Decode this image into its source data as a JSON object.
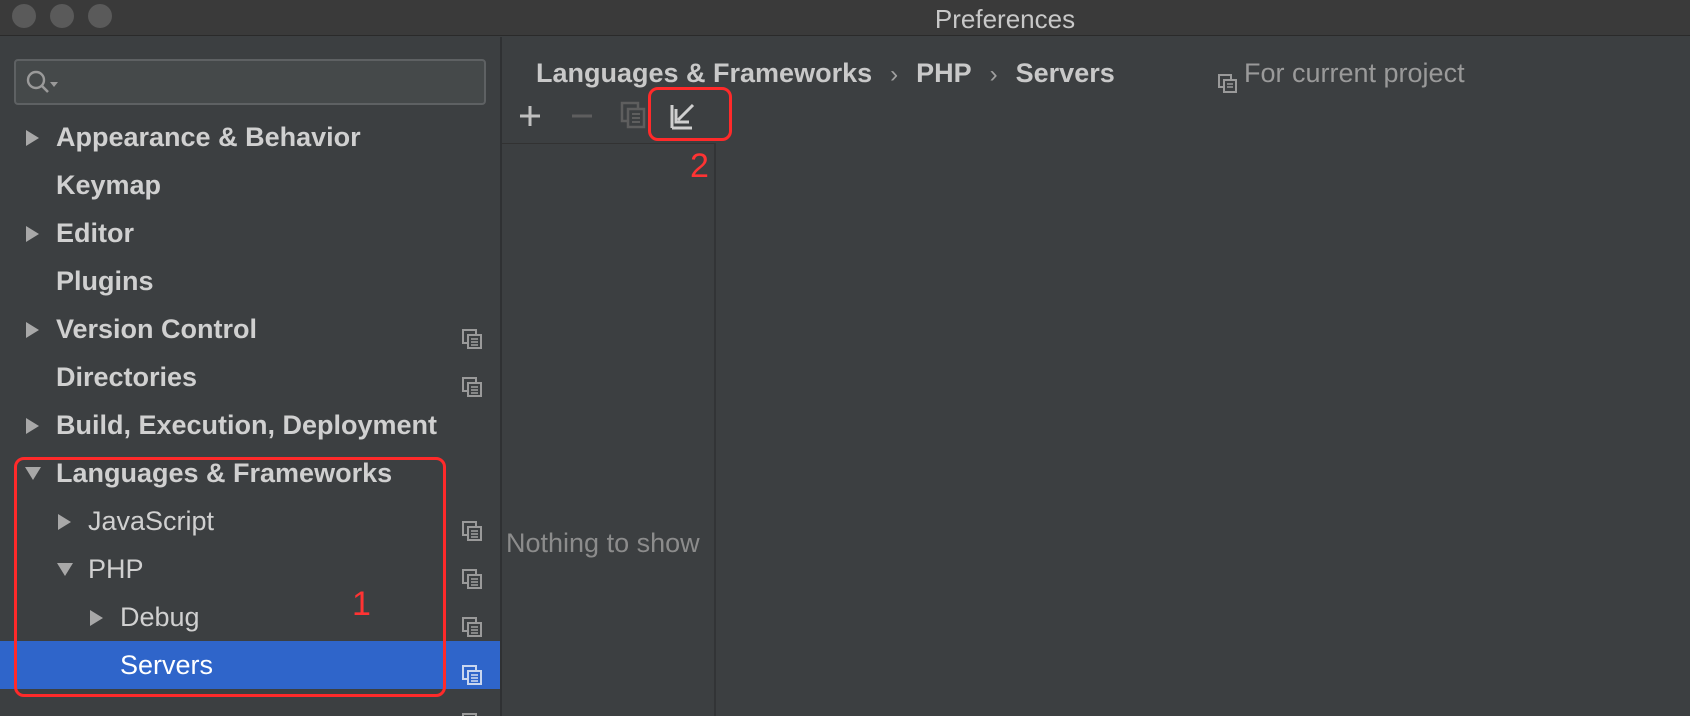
{
  "window": {
    "title": "Preferences"
  },
  "sidebar": {
    "search": {
      "value": "",
      "placeholder": ""
    },
    "items": [
      {
        "label": "Appearance & Behavior",
        "expandable": true,
        "expanded": false,
        "level": 0
      },
      {
        "label": "Keymap",
        "expandable": false,
        "level": 0
      },
      {
        "label": "Editor",
        "expandable": true,
        "expanded": false,
        "level": 0
      },
      {
        "label": "Plugins",
        "expandable": false,
        "level": 0
      },
      {
        "label": "Version Control",
        "expandable": true,
        "expanded": false,
        "level": 0,
        "project_icon": true
      },
      {
        "label": "Directories",
        "expandable": false,
        "level": 0,
        "project_icon": true
      },
      {
        "label": "Build, Execution, Deployment",
        "expandable": true,
        "expanded": false,
        "level": 0
      },
      {
        "label": "Languages & Frameworks",
        "expandable": true,
        "expanded": true,
        "level": 0
      },
      {
        "label": "JavaScript",
        "expandable": true,
        "expanded": false,
        "level": 1,
        "project_icon": true
      },
      {
        "label": "PHP",
        "expandable": true,
        "expanded": true,
        "level": 1,
        "project_icon": true
      },
      {
        "label": "Debug",
        "expandable": true,
        "expanded": false,
        "level": 2,
        "project_icon": true
      },
      {
        "label": "Servers",
        "expandable": false,
        "level": 2,
        "project_icon": true,
        "selected": true
      }
    ]
  },
  "annotations": {
    "one": "1",
    "two": "2",
    "color": "#ff2a2a"
  },
  "main": {
    "breadcrumb": [
      "Languages & Frameworks",
      "PHP",
      "Servers"
    ],
    "breadcrumb_separator": "›",
    "scope_label": "For current project",
    "toolbar": {
      "add": "plus-icon",
      "remove": "minus-icon",
      "copy": "copy-icon",
      "import": "import-arrow-icon"
    },
    "empty_text": "Nothing to show"
  },
  "colors": {
    "background": "#3c3f41",
    "selection": "#2f65ca",
    "text": "#d0d0d0"
  }
}
